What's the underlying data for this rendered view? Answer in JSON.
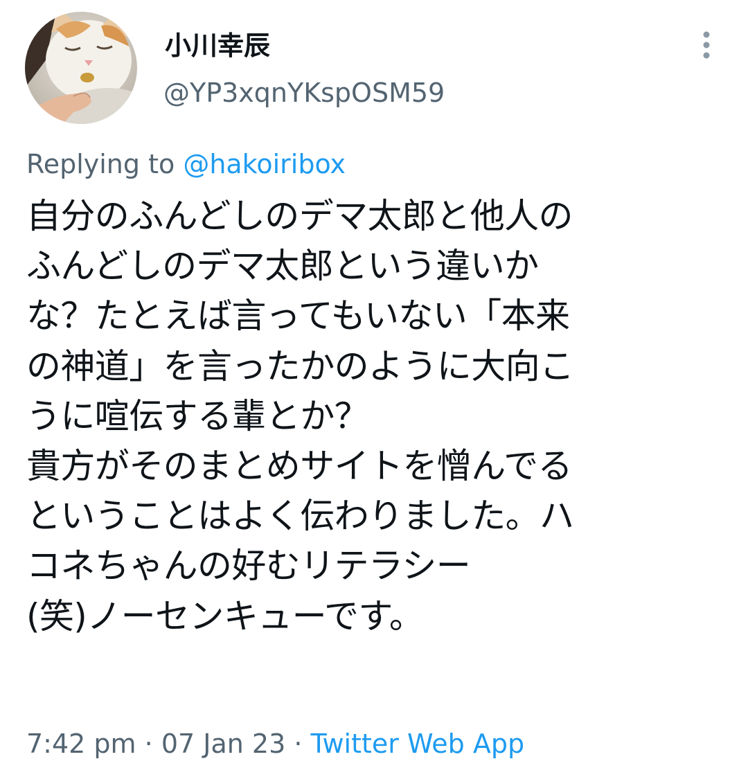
{
  "author": {
    "display_name": "小川幸辰",
    "handle": "@YP3xqnYKspOSM59"
  },
  "reply": {
    "prefix": "Replying to ",
    "to_handle": "@hakoiribox"
  },
  "tweet": {
    "lines": [
      "自分のふんどしのデマ太郎と他人の",
      "ふんどしのデマ太郎という違いか",
      "な？たとえば言ってもいない「本来",
      "の神道」を言ったかのように大向こ",
      "うに喧伝する輩とか？",
      "貴方がそのまとめサイトを憎んでる",
      "ということはよく伝わりました。ハ",
      "コネちゃんの好むリテラシー",
      "(笑)ノーセンキューです。"
    ]
  },
  "meta": {
    "time": "7:42 pm",
    "sep1": " · ",
    "date": "07 Jan 23",
    "sep2": " · ",
    "source": "Twitter Web App"
  },
  "icons": {
    "more": "more-vertical-icon",
    "avatar": "cat-photo-avatar"
  },
  "colors": {
    "text": "#0f1419",
    "secondary": "#536471",
    "link": "#1d9bf0"
  }
}
